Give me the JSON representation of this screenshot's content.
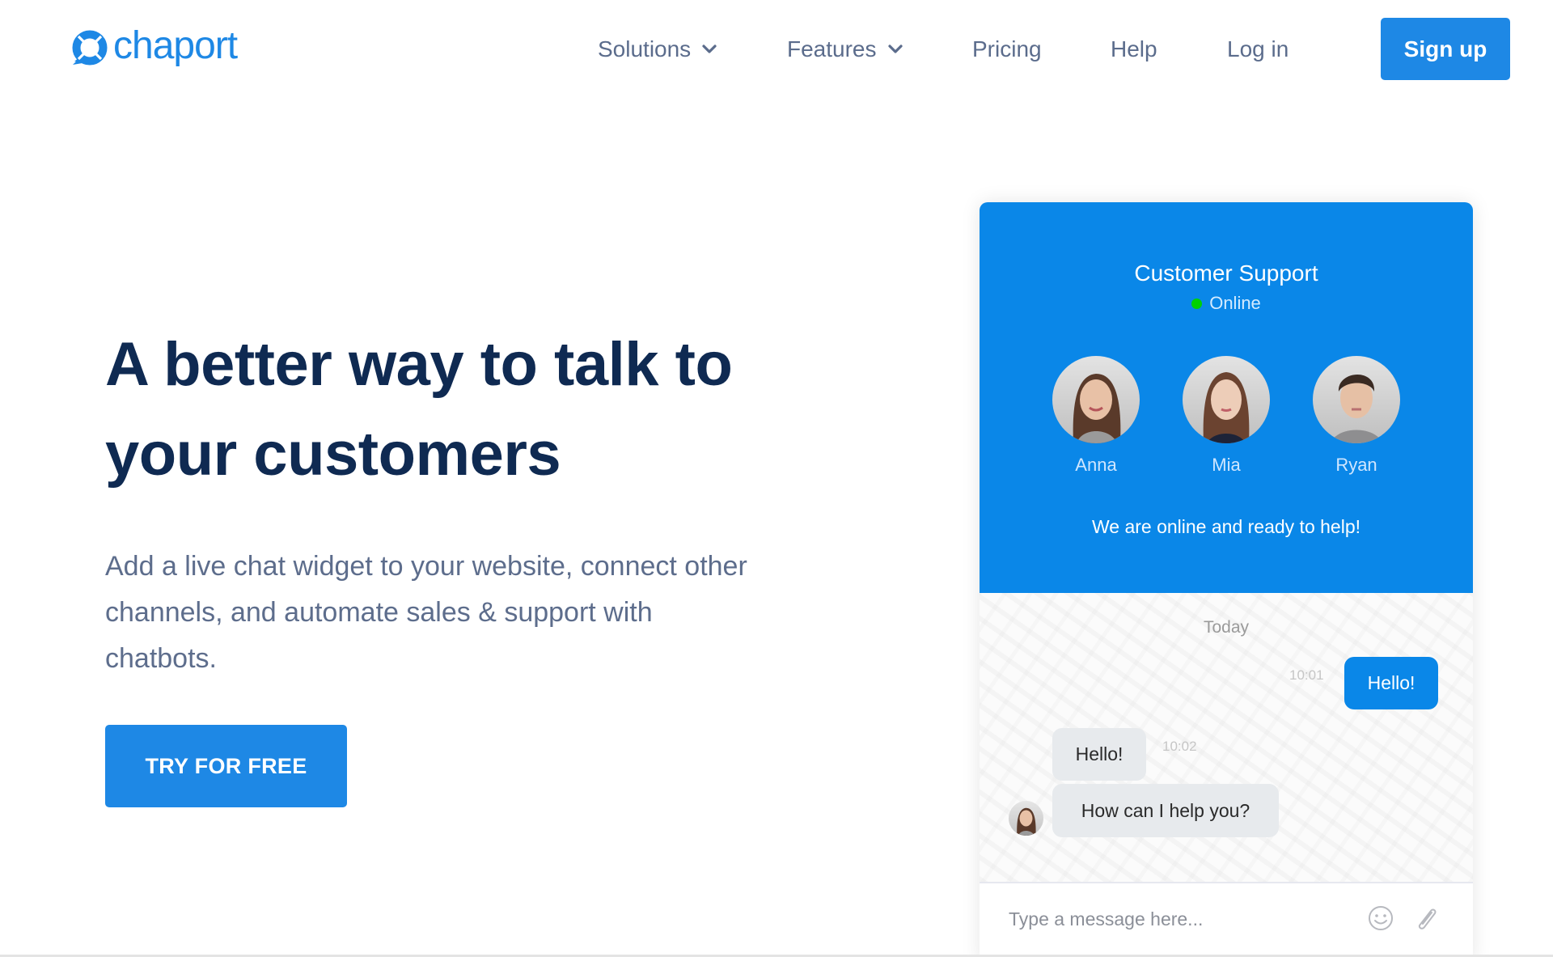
{
  "brand": {
    "name": "chaport",
    "color": "#1e88e5"
  },
  "nav": {
    "items": [
      {
        "label": "Solutions",
        "has_dropdown": true
      },
      {
        "label": "Features",
        "has_dropdown": true
      },
      {
        "label": "Pricing",
        "has_dropdown": false
      },
      {
        "label": "Help",
        "has_dropdown": false
      },
      {
        "label": "Log in",
        "has_dropdown": false
      }
    ],
    "signup_label": "Sign up"
  },
  "hero": {
    "title": "A better way to talk to your customers",
    "subtitle": "Add a live chat widget to your website, connect other channels, and automate sales & support with chatbots.",
    "cta_label": "TRY FOR FREE"
  },
  "chat_widget": {
    "title": "Customer Support",
    "status": "Online",
    "status_color": "#00d200",
    "header_color": "#0a87e8",
    "agents": [
      {
        "name": "Anna"
      },
      {
        "name": "Mia"
      },
      {
        "name": "Ryan"
      }
    ],
    "tagline": "We are online and ready to help!",
    "day_label": "Today",
    "messages": [
      {
        "from": "visitor",
        "text": "Hello!",
        "time": "10:01"
      },
      {
        "from": "agent",
        "text": "Hello!",
        "time": "10:02"
      },
      {
        "from": "agent",
        "text": "How can I help you?",
        "time": ""
      }
    ],
    "input_placeholder": "Type a message here...",
    "icons": {
      "emoji": "smiley-icon",
      "attach": "paperclip-icon"
    }
  }
}
